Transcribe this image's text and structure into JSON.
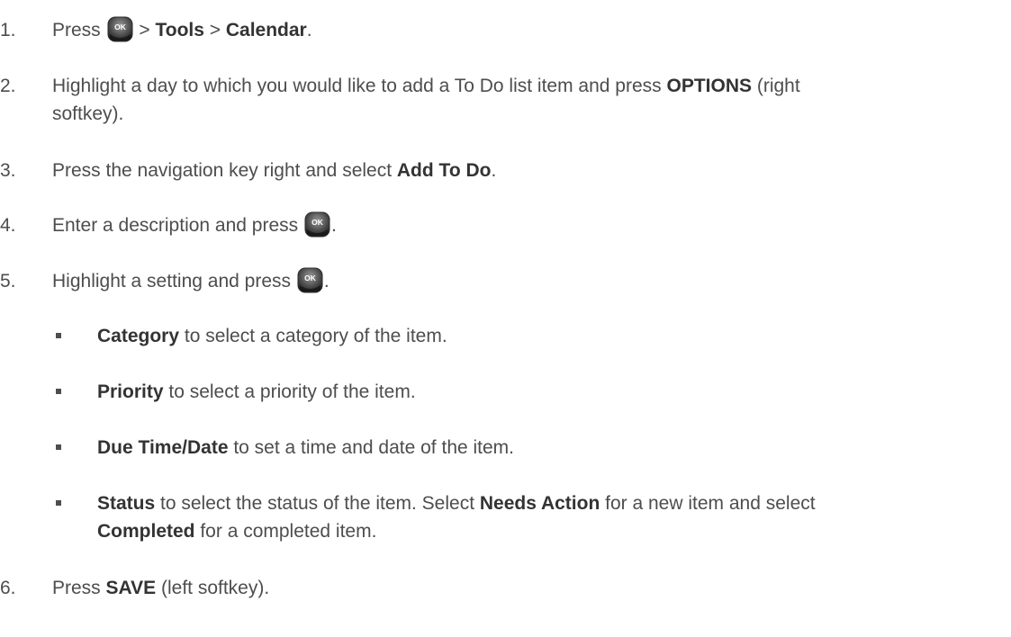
{
  "steps": [
    {
      "num": "1.",
      "t1": "Press",
      "sep1": " > ",
      "b1": "Tools",
      "sep2": " > ",
      "b2": "Calendar",
      "end": "."
    },
    {
      "num": "2.",
      "t1": "Highlight a day to which you would like to add a To Do list item and press ",
      "b1": "OPTIONS",
      "t2": " (right",
      "t3": "softkey)."
    },
    {
      "num": "3.",
      "t1": "Press the navigation key right and select ",
      "b1": "Add To Do",
      "end": "."
    },
    {
      "num": "4.",
      "t1": "Enter a description and press",
      "end": "."
    },
    {
      "num": "5.",
      "t1": "Highlight a setting and press",
      "end": "."
    },
    {
      "num": "6.",
      "t1": "Press ",
      "b1": "SAVE",
      "t2": " (left softkey)."
    }
  ],
  "bullets": [
    {
      "b1": "Category",
      "t1": " to select a category of the item."
    },
    {
      "b1": "Priority",
      "t1": " to select a priority of the item."
    },
    {
      "b1": "Due Time/Date",
      "t1": " to set a time and date of the item."
    },
    {
      "b1": "Status",
      "t1": " to select the status of the item. Select ",
      "b2": "Needs Action",
      "t2": " for a new item and select",
      "b3": "Completed",
      "t3": " for a completed item."
    }
  ],
  "icons": {
    "ok_key": "ok-key-icon",
    "ok_label": "OK"
  }
}
